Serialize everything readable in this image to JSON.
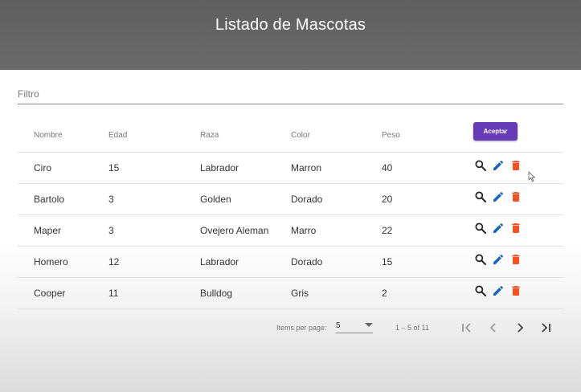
{
  "header": {
    "title": "Listado de Mascotas"
  },
  "filter": {
    "placeholder": "Filtro"
  },
  "table": {
    "columns": [
      "Nombre",
      "Edad",
      "Raza",
      "Color",
      "Peso"
    ],
    "accept_label": "Aceptar",
    "rows": [
      {
        "nombre": "Ciro",
        "edad": "15",
        "raza": "Labrador",
        "color": "Marron",
        "peso": "40"
      },
      {
        "nombre": "Bartolo",
        "edad": "3",
        "raza": "Golden",
        "color": "Dorado",
        "peso": "20"
      },
      {
        "nombre": "Maper",
        "edad": "3",
        "raza": "Ovejero Aleman",
        "color": "Marro",
        "peso": "22"
      },
      {
        "nombre": "Homero",
        "edad": "12",
        "raza": "Labrador",
        "color": "Dorado",
        "peso": "15"
      },
      {
        "nombre": "Cooper",
        "edad": "11",
        "raza": "Bulldog",
        "color": "Gris",
        "peso": "2"
      }
    ],
    "row_actions": [
      "search-icon",
      "edit-icon",
      "delete-icon"
    ]
  },
  "paginator": {
    "items_per_page_label": "Items per page:",
    "page_size": "5",
    "range_label": "1 – 5 of 11"
  },
  "colors": {
    "toolbar": "#5f5f5f",
    "accent": "#673ab7",
    "edit": "#1565c0",
    "delete": "#f4511e"
  }
}
